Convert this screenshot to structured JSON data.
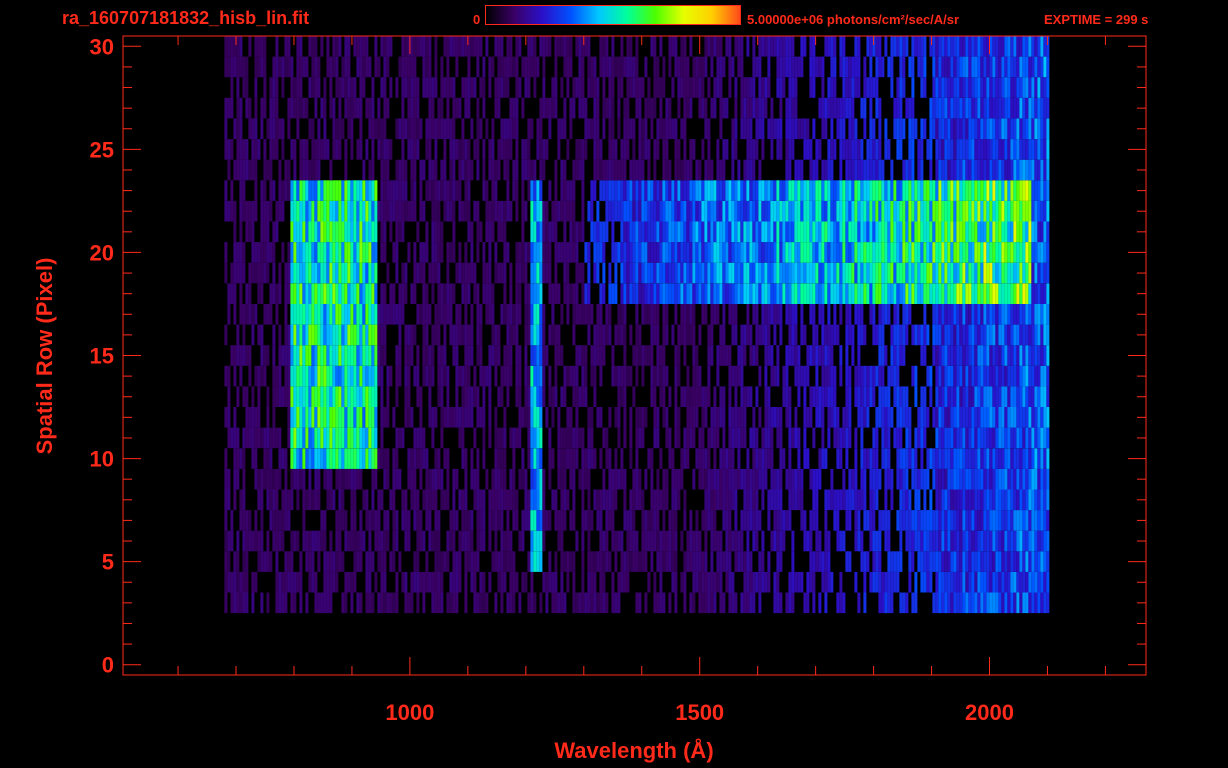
{
  "header": {
    "file_name": "ra_160707181832_hisb_lin.fit",
    "colorbar_min": "0",
    "colorbar_max_label": "5.00000e+06 photons/cm²/sec/A/sr",
    "exptime": "EXPTIME = 299 s"
  },
  "colors": {
    "axis": "#ff2a1a",
    "background": "#000000",
    "colormap": [
      "#000000",
      "#3a0066",
      "#2a10c8",
      "#0050ff",
      "#00c8ff",
      "#00ff9a",
      "#4cff00",
      "#e6ff00",
      "#ffd000",
      "#ff4a1a"
    ]
  },
  "chart_data": {
    "type": "heatmap",
    "title": "",
    "xlabel": "Wavelength (Å)",
    "ylabel": "Spatial Row (Pixel)",
    "xlim": [
      505,
      2270
    ],
    "ylim": [
      -0.5,
      30.5
    ],
    "x_ticks": [
      1000,
      1500,
      2000
    ],
    "y_ticks": [
      0,
      5,
      10,
      15,
      20,
      25,
      30
    ],
    "colorbar_range": [
      0,
      5000000
    ],
    "colorbar_units": "photons/cm²/sec/A/sr",
    "data_extent": {
      "wavelength": [
        680,
        2100
      ],
      "rows": [
        0,
        30
      ]
    },
    "features": [
      {
        "label": "extended arc emission (left)",
        "wavelength": [
          790,
          940
        ],
        "rows": [
          10,
          23
        ],
        "relative_intensity": 0.62
      },
      {
        "label": "emission line",
        "wavelength": [
          1205,
          1225
        ],
        "rows": [
          5,
          23
        ],
        "relative_intensity": 0.5
      },
      {
        "label": "continuum band",
        "wavelength": [
          1300,
          2070
        ],
        "rows": [
          18,
          23
        ],
        "relative_intensity": 0.75
      }
    ]
  }
}
